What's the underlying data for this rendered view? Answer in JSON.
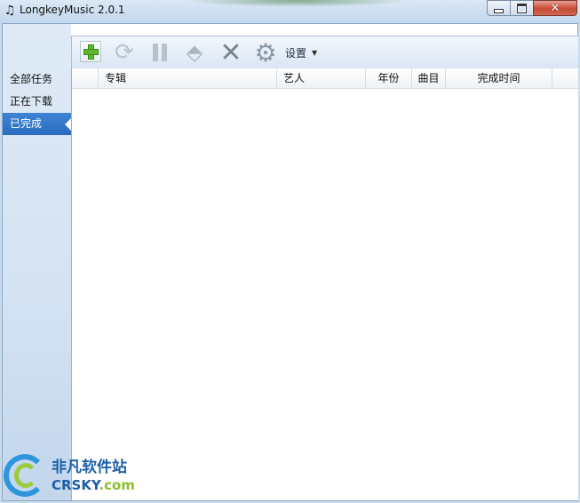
{
  "window": {
    "title": "LongkeyMusic 2.0.1",
    "app_icon": "music-note-icon",
    "controls": {
      "minimize": "minimize-icon",
      "maximize": "maximize-icon",
      "close": "✕"
    }
  },
  "toolbar": {
    "buttons": [
      {
        "name": "add",
        "icon": "plus-icon"
      },
      {
        "name": "refresh",
        "icon": "refresh-icon"
      },
      {
        "name": "pause",
        "icon": "pause-icon"
      },
      {
        "name": "move",
        "icon": "move-icon"
      },
      {
        "name": "delete",
        "icon": "delete-icon"
      },
      {
        "name": "settings",
        "icon": "gear-icon"
      }
    ],
    "settings_label": "设置",
    "settings_caret": "▼"
  },
  "sidebar": {
    "items": [
      {
        "label": "全部任务",
        "active": false
      },
      {
        "label": "正在下载",
        "active": false
      },
      {
        "label": "已完成",
        "active": true
      }
    ]
  },
  "table": {
    "columns": [
      "",
      "专辑",
      "艺人",
      "年份",
      "曲目",
      "完成时间",
      ""
    ],
    "rows": []
  },
  "watermark": {
    "cn_text": "非凡软件站",
    "en_text": "CRSKY",
    "en_suffix": ".com"
  },
  "colors": {
    "accent": "#2a6cbf",
    "sidebar_bg": "#d3e2f2",
    "plus_green": "#5db82e",
    "close_red": "#c74a33"
  }
}
